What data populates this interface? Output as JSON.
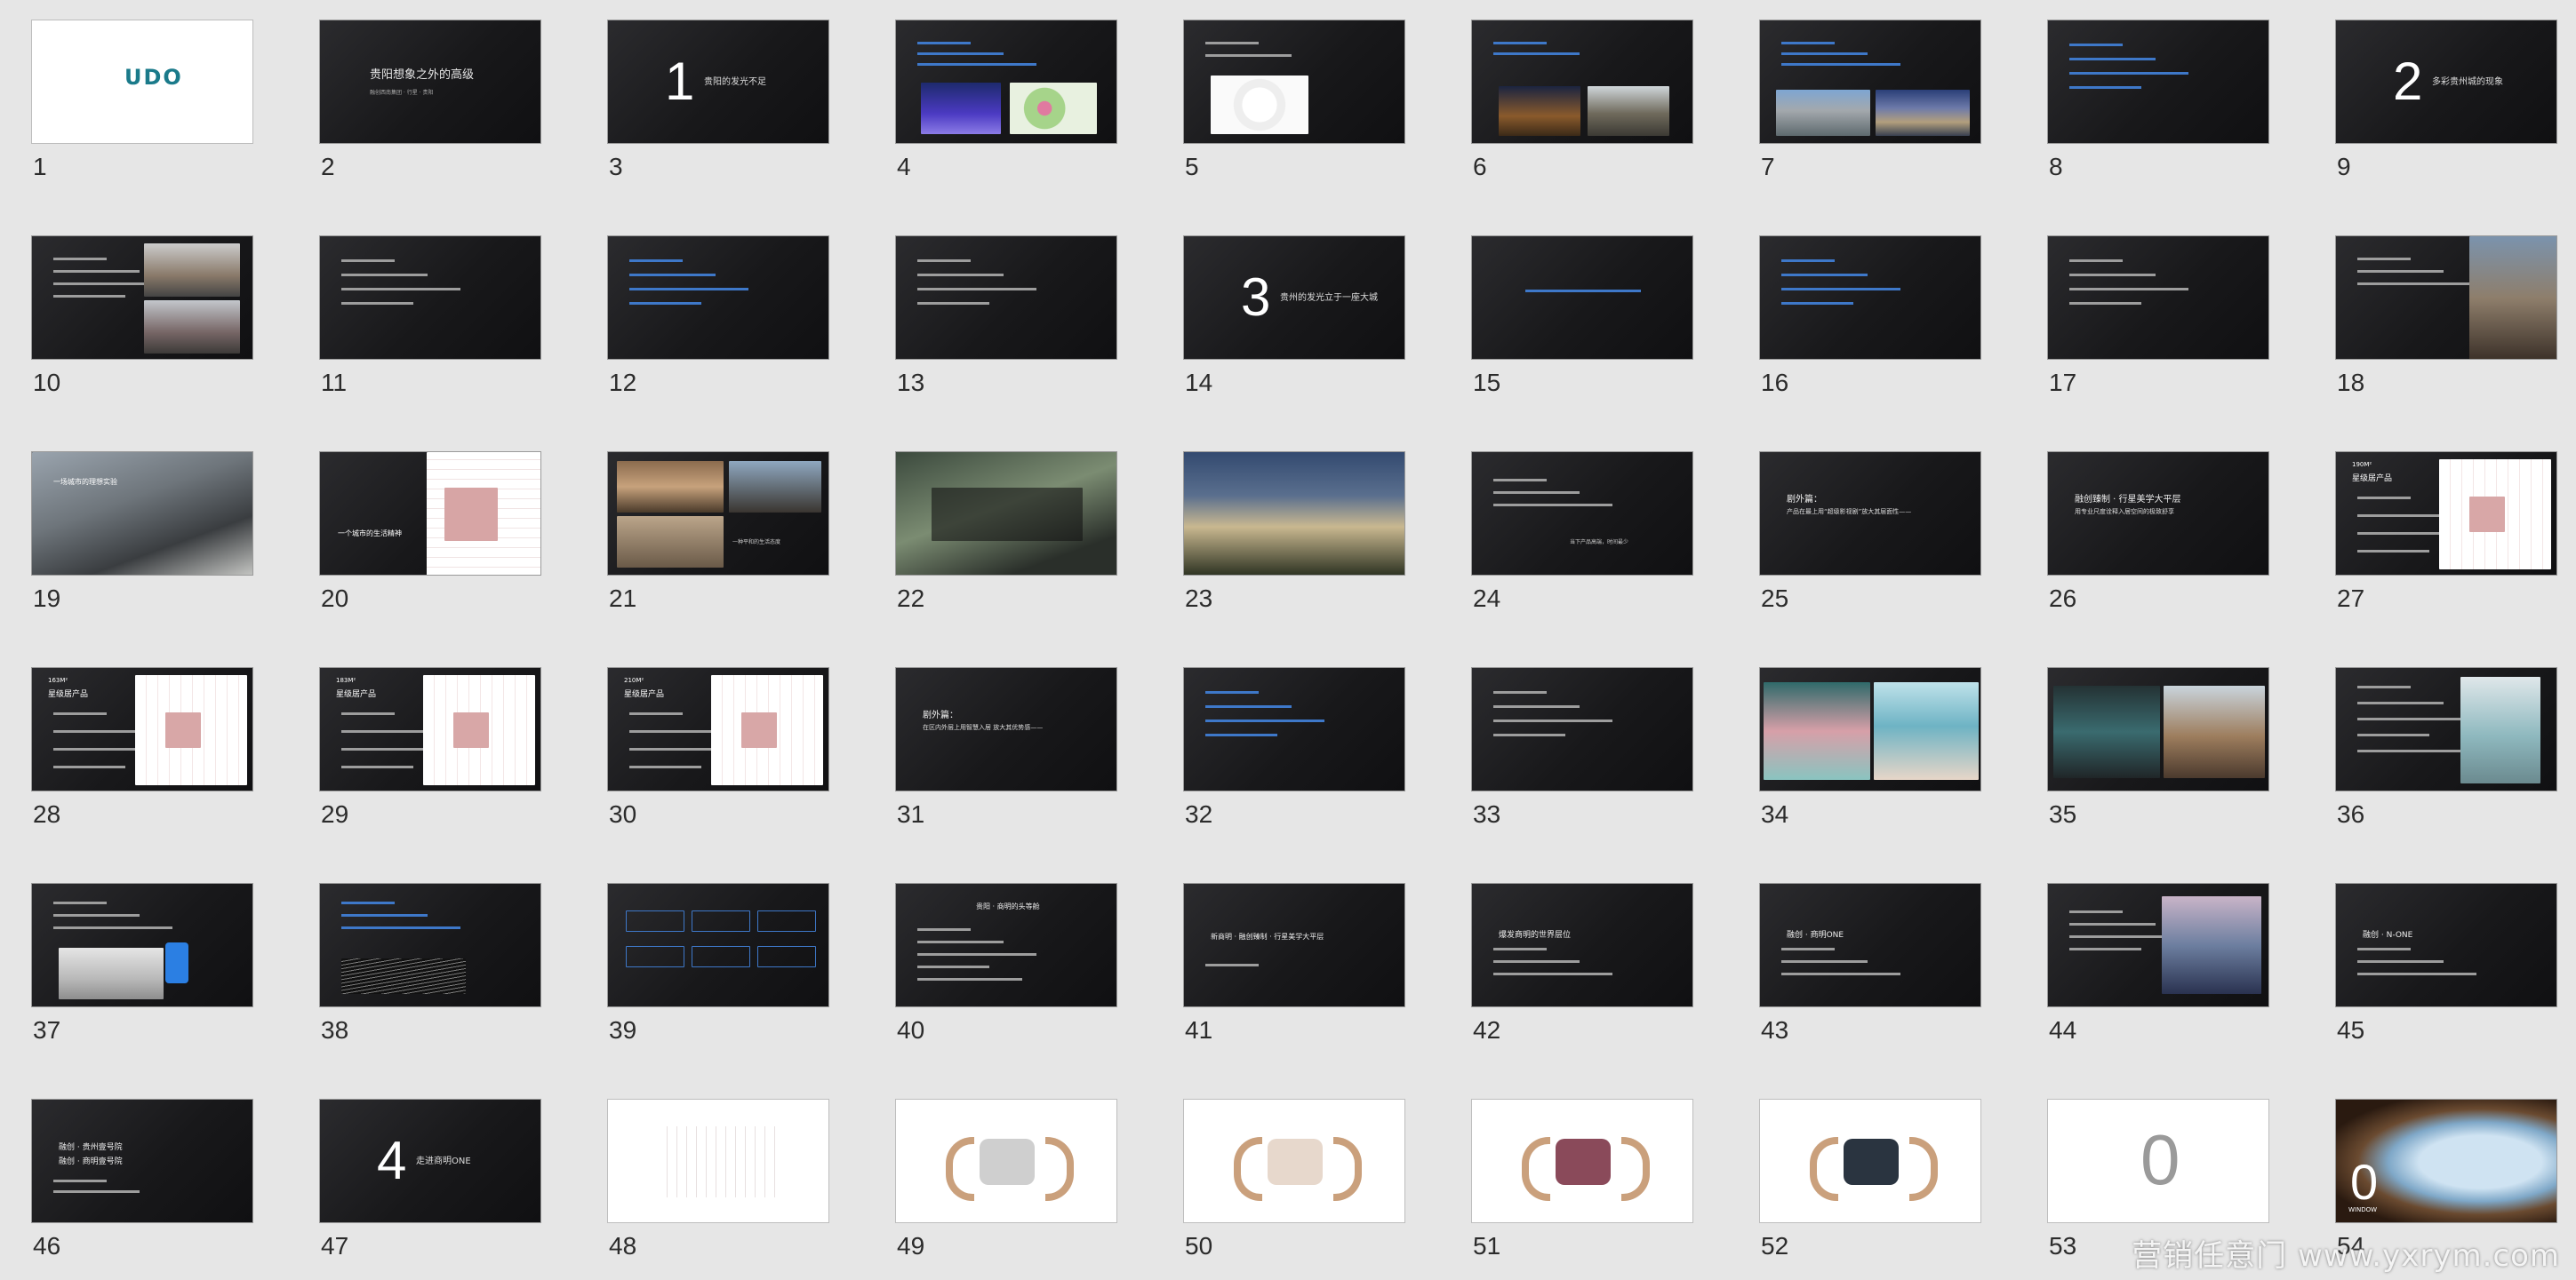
{
  "slides": [
    {
      "n": "1",
      "title": "UDO",
      "style": "logo"
    },
    {
      "n": "2",
      "title": "贵阳想象之外的高级",
      "sub": "融创西南集团 · 行星 · 贵阳",
      "style": "title"
    },
    {
      "n": "3",
      "title": "贵阳的发光不足",
      "big": "1",
      "style": "chapter"
    },
    {
      "n": "4",
      "title": "",
      "style": "img2"
    },
    {
      "n": "5",
      "title": "",
      "style": "map"
    },
    {
      "n": "6",
      "title": "",
      "style": "img2b"
    },
    {
      "n": "7",
      "title": "",
      "style": "img2c"
    },
    {
      "n": "8",
      "title": "",
      "style": "text"
    },
    {
      "n": "9",
      "title": "多彩贵州城的现象",
      "big": "2",
      "style": "chapter"
    },
    {
      "n": "10",
      "title": "",
      "style": "imgright2"
    },
    {
      "n": "11",
      "title": "",
      "style": "text"
    },
    {
      "n": "12",
      "title": "",
      "style": "text"
    },
    {
      "n": "13",
      "title": "",
      "style": "text"
    },
    {
      "n": "14",
      "title": "贵州的发光立于一座大城",
      "big": "3",
      "style": "chapter"
    },
    {
      "n": "15",
      "title": "",
      "style": "textcenter"
    },
    {
      "n": "16",
      "title": "",
      "style": "text"
    },
    {
      "n": "17",
      "title": "",
      "style": "text"
    },
    {
      "n": "18",
      "title": "",
      "style": "imgright"
    },
    {
      "n": "19",
      "title": "一场城市的理想实验",
      "style": "photo"
    },
    {
      "n": "20",
      "title": "一个城市的生活精神",
      "style": "plan"
    },
    {
      "n": "21",
      "title": "一种平和的生活态度",
      "style": "photo2"
    },
    {
      "n": "22",
      "title": "",
      "style": "photo3"
    },
    {
      "n": "23",
      "title": "",
      "style": "building"
    },
    {
      "n": "24",
      "title": "当下产品高端，时间最少",
      "style": "text2"
    },
    {
      "n": "25",
      "title": "剧外篇：",
      "sub": "产品在最上用“超级影视剧”放大其层面性——",
      "style": "bigtext"
    },
    {
      "n": "26",
      "title": "融创臻制 · 行星美学大平层",
      "sub": "用专业尺度诠释入居空间的极致舒享",
      "style": "bigtext"
    },
    {
      "n": "27",
      "title": "190M²",
      "sub": "星级居产品",
      "style": "planright"
    },
    {
      "n": "28",
      "title": "163M²",
      "sub": "星级居产品",
      "style": "planright"
    },
    {
      "n": "29",
      "title": "183M²",
      "sub": "星级居产品",
      "style": "planright"
    },
    {
      "n": "30",
      "title": "210M²",
      "sub": "星级居产品",
      "style": "planright"
    },
    {
      "n": "31",
      "title": "剧外篇：",
      "sub": "在区内外层上用智慧入居 放大其优势感——",
      "style": "bigtext"
    },
    {
      "n": "32",
      "title": "",
      "style": "text"
    },
    {
      "n": "33",
      "title": "",
      "style": "text"
    },
    {
      "n": "34",
      "title": "",
      "style": "interior"
    },
    {
      "n": "35",
      "title": "",
      "style": "interior2"
    },
    {
      "n": "36",
      "title": "",
      "style": "imgright3"
    },
    {
      "n": "37",
      "title": "",
      "style": "imgleft"
    },
    {
      "n": "38",
      "title": "",
      "style": "lines"
    },
    {
      "n": "39",
      "title": "",
      "style": "boxes"
    },
    {
      "n": "40",
      "title": "贵阳 · 商明的头等舱",
      "style": "table"
    },
    {
      "n": "41",
      "title": "新商明 · 融创臻制 · 行星美学大平层",
      "style": "tree"
    },
    {
      "n": "42",
      "title": "爆发商明的世界层位",
      "style": "text3"
    },
    {
      "n": "43",
      "title": "融创 · 商明ONE",
      "style": "text3"
    },
    {
      "n": "44",
      "title": "",
      "style": "city"
    },
    {
      "n": "45",
      "title": "融创 · N-ONE",
      "style": "text3"
    },
    {
      "n": "46",
      "title": "融创 · 贵州壹号院",
      "sub": "融创 · 商明壹号院",
      "style": "text4"
    },
    {
      "n": "47",
      "title": "走进商明ONE",
      "big": "4",
      "style": "chapter"
    },
    {
      "n": "48",
      "title": "",
      "style": "lightplan"
    },
    {
      "n": "49",
      "title": "",
      "style": "lightcar"
    },
    {
      "n": "50",
      "title": "",
      "style": "lightyoga"
    },
    {
      "n": "51",
      "title": "",
      "style": "lightbag"
    },
    {
      "n": "52",
      "title": "",
      "style": "lightcoat"
    },
    {
      "n": "53",
      "title": "",
      "style": "lightzero"
    },
    {
      "n": "54",
      "title": "WINDOW",
      "big": "0",
      "style": "window"
    }
  ],
  "watermark": "营销任意门 www.yxrym.com",
  "colors": {
    "bg": "#e6e6e6",
    "slide_dark": "#1b1b1d",
    "accent_blue": "#3e78c9",
    "bracket": "#caa07c"
  }
}
